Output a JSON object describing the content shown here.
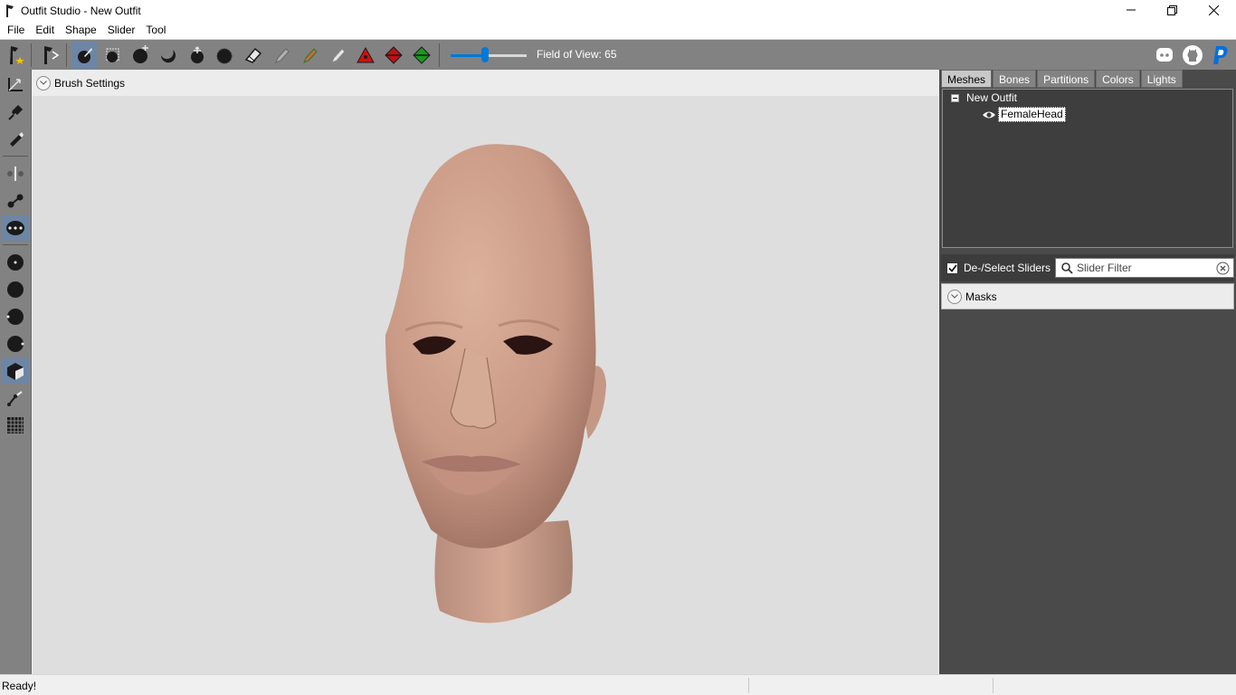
{
  "window": {
    "title": "Outfit Studio - New Outfit"
  },
  "menu": [
    "File",
    "Edit",
    "Shape",
    "Slider",
    "Tool"
  ],
  "toolbar": {
    "fov_label": "Field of View: 65",
    "fov_value": 65,
    "tools": [
      "new-project-icon",
      "load-reference-icon",
      "select-brush-icon",
      "mask-brush-icon",
      "inflate-brush-icon",
      "deflate-brush-icon",
      "move-brush-icon",
      "smooth-brush-icon",
      "undiff-brush-icon",
      "weight-brush-icon",
      "color-brush-icon",
      "alpha-brush-icon",
      "collapse-vertex-icon",
      "flip-edge-icon",
      "split-edge-icon"
    ],
    "social": [
      "discord-icon",
      "github-icon",
      "paypal-icon"
    ]
  },
  "viewport": {
    "brush_settings_label": "Brush Settings"
  },
  "right_panel": {
    "tabs": [
      "Meshes",
      "Bones",
      "Partitions",
      "Colors",
      "Lights"
    ],
    "active_tab": "Meshes",
    "tree": {
      "root": "New Outfit",
      "child": "FemaleHead"
    },
    "deselect_label": "De-/Select Sliders",
    "filter_placeholder": "Slider Filter",
    "masks_label": "Masks"
  },
  "status": {
    "text": "Ready!"
  },
  "colors": {
    "toolbar_bg": "#828282",
    "active_tool": "#6d86a5",
    "panel_bg": "#4a4a4a",
    "viewport_bg": "#dedede"
  }
}
